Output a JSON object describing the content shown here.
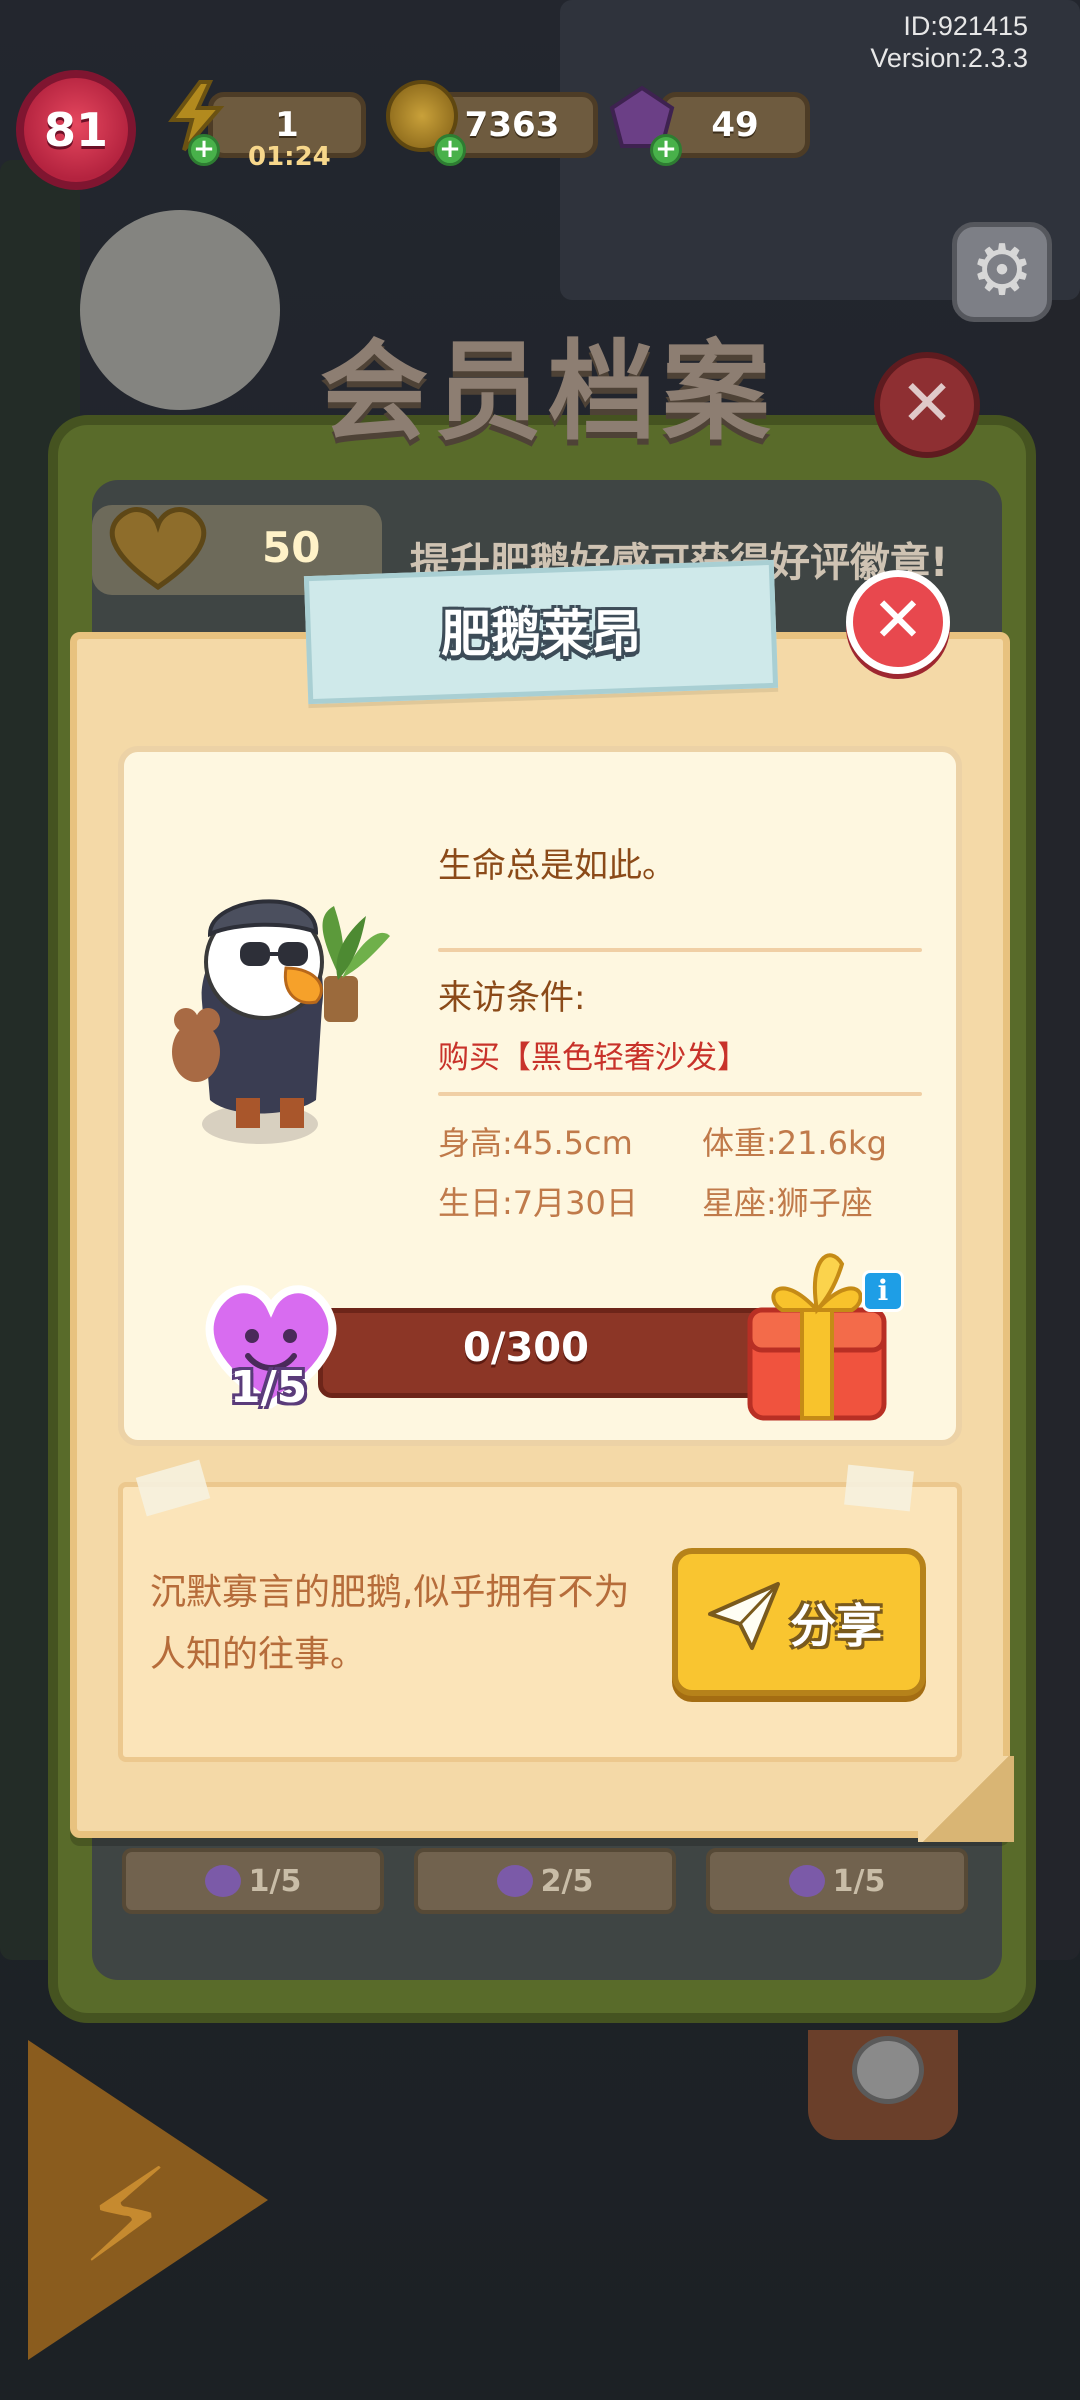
{
  "header": {
    "id_text": "ID:921415",
    "version_text": "Version:2.3.3",
    "level": "81",
    "energy": "1",
    "energy_timer": "01:24",
    "coins": "7363",
    "gems": "49"
  },
  "archive": {
    "title": "会员档案",
    "heart_score": "50",
    "hint": "提升肥鹅好感可获得好评徽章!",
    "slots": [
      "1/5",
      "2/5",
      "1/5"
    ]
  },
  "dialog": {
    "name": "肥鹅莱昂",
    "quote": "生命总是如此。",
    "condition_label": "来访条件:",
    "condition_value": "购买【黑色轻奢沙发】",
    "height": "身高:45.5cm",
    "weight": "体重:21.6kg",
    "birthday": "生日:7月30日",
    "zodiac": "星座:狮子座",
    "affection_level": "1/5",
    "progress_text": "0/300",
    "progress": 0,
    "description": "沉默寡言的肥鹅,似乎拥有不为人知的往事。",
    "share_label": "分享",
    "close_icon": "close-icon",
    "info_icon": "info-icon"
  },
  "colors": {
    "accent_yellow": "#f9c530",
    "close_red": "#e8484e",
    "bar_brown": "#8c3626",
    "heart_purple": "#d86cf0"
  }
}
